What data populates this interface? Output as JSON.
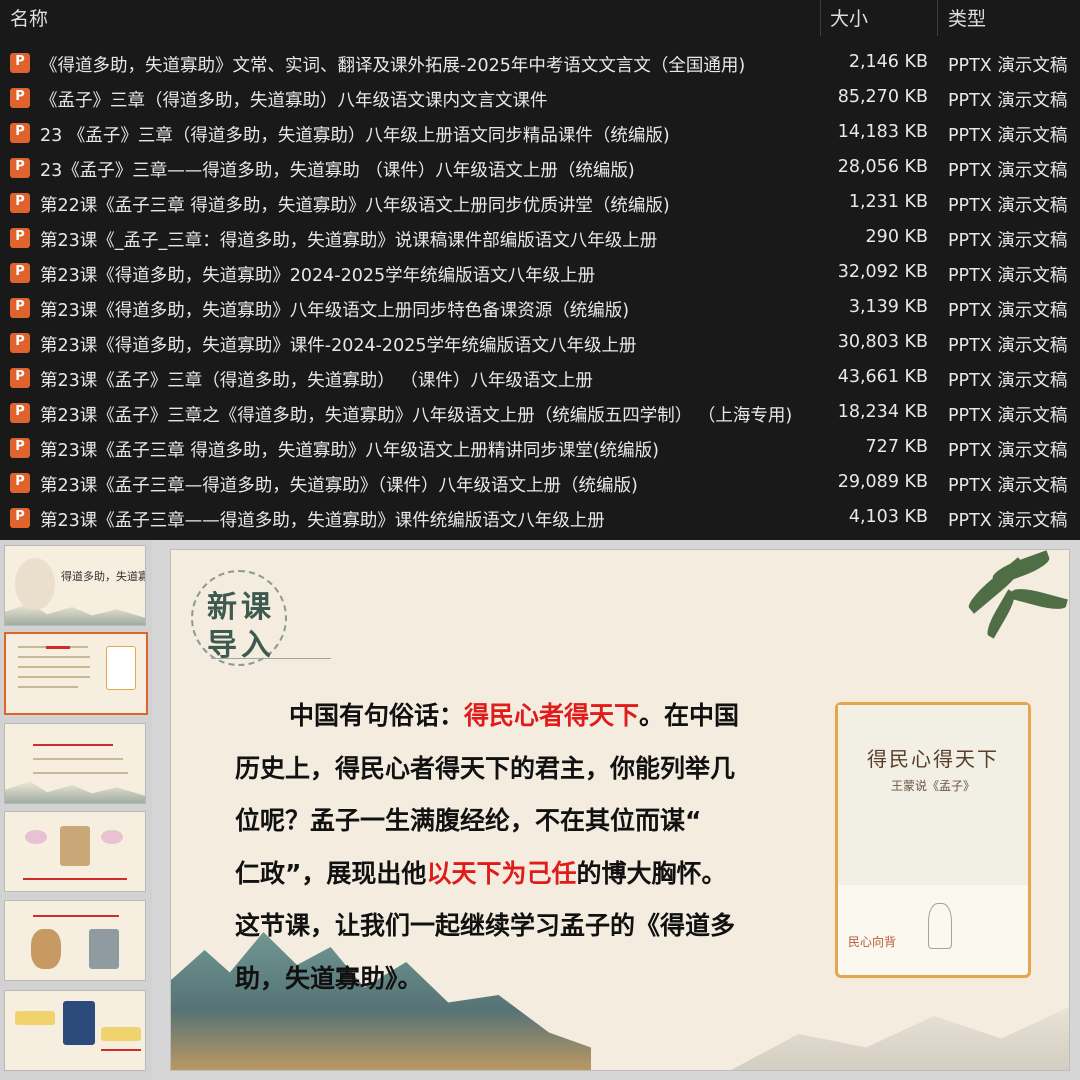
{
  "explorer": {
    "columns": {
      "name": "名称",
      "size": "大小",
      "type": "类型"
    },
    "files": [
      {
        "name": "《得道多助，失道寡助》文常、实词、翻译及课外拓展-2025年中考语文文言文（全国通用)",
        "size": "2,146 KB",
        "type": "PPTX 演示文稿"
      },
      {
        "name": "《孟子》三章（得道多助，失道寡助）八年级语文课内文言文课件",
        "size": "85,270 KB",
        "type": "PPTX 演示文稿"
      },
      {
        "name": "23 《孟子》三章（得道多助，失道寡助）八年级上册语文同步精品课件（统编版)",
        "size": "14,183 KB",
        "type": "PPTX 演示文稿"
      },
      {
        "name": "23《孟子》三章——得道多助，失道寡助 （课件）八年级语文上册（统编版)",
        "size": "28,056 KB",
        "type": "PPTX 演示文稿"
      },
      {
        "name": "第22课《孟子三章 得道多助，失道寡助》八年级语文上册同步优质讲堂（统编版)",
        "size": "1,231 KB",
        "type": "PPTX 演示文稿"
      },
      {
        "name": "第23课《_孟子_三章：得道多助，失道寡助》说课稿课件部编版语文八年级上册",
        "size": "290 KB",
        "type": "PPTX 演示文稿"
      },
      {
        "name": "第23课《得道多助，失道寡助》2024-2025学年统编版语文八年级上册",
        "size": "32,092 KB",
        "type": "PPTX 演示文稿"
      },
      {
        "name": "第23课《得道多助，失道寡助》八年级语文上册同步特色备课资源（统编版)",
        "size": "3,139 KB",
        "type": "PPTX 演示文稿"
      },
      {
        "name": "第23课《得道多助，失道寡助》课件-2024-2025学年统编版语文八年级上册",
        "size": "30,803 KB",
        "type": "PPTX 演示文稿"
      },
      {
        "name": "第23课《孟子》三章（得道多助，失道寡助） （课件）八年级语文上册",
        "size": "43,661 KB",
        "type": "PPTX 演示文稿"
      },
      {
        "name": "第23课《孟子》三章之《得道多助，失道寡助》八年级语文上册（统编版五四学制） （上海专用)",
        "size": "18,234 KB",
        "type": "PPTX 演示文稿"
      },
      {
        "name": "第23课《孟子三章 得道多助，失道寡助》八年级语文上册精讲同步课堂(统编版)",
        "size": "727 KB",
        "type": "PPTX 演示文稿"
      },
      {
        "name": "第23课《孟子三章—得道多助，失道寡助》（课件）八年级语文上册（统编版)",
        "size": "29,089 KB",
        "type": "PPTX 演示文稿"
      },
      {
        "name": "第23课《孟子三章——得道多助，失道寡助》课件统编版语文八年级上册",
        "size": "4,103 KB",
        "type": "PPTX 演示文稿"
      }
    ]
  },
  "thumbnails": [
    {
      "title": "得道多助，失道寡助"
    }
  ],
  "slide": {
    "stamp_line1": "新课",
    "stamp_line2": "导入",
    "line1_a": "中国有句俗话：",
    "line1_red": "得民心者得天下",
    "line1_b": "。在中国",
    "line2": "历史上，得民心者得天下的君主，你能列举几",
    "line3": "位呢？孟子一生满腹经纶，不在其位而谋“",
    "line4_a": "仁政”，展现出他",
    "line4_red": "以天下为己任",
    "line4_b": "的博大胸怀。",
    "line5": "这节课，让我们一起继续学习孟子的《得道多",
    "line6": "助，失道寡助》。",
    "book": {
      "title": "得民心得天下",
      "subtitle": "王蒙说《孟子》",
      "footer": "民心向背"
    }
  },
  "colors": {
    "accent_red": "#e11a1a",
    "file_icon": "#e0622c",
    "book_border": "#e6a64d"
  },
  "icons": {
    "file": "pptx-file-icon"
  }
}
